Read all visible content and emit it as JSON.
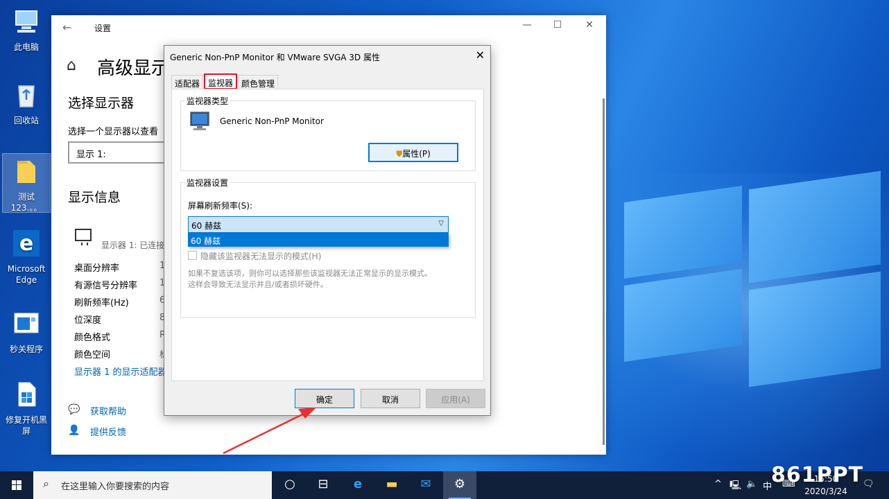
{
  "desktop": {
    "icons": [
      {
        "label": "此电脑",
        "icon": "computer-icon"
      },
      {
        "label": "回收站",
        "icon": "recycle-bin-icon"
      },
      {
        "label": "测试123.。。",
        "icon": "folder-icon"
      },
      {
        "label": "Microsoft Edge",
        "icon": "edge-icon"
      },
      {
        "label": "秒关程序",
        "icon": "app-window-icon"
      },
      {
        "label": "修复开机黑屏",
        "icon": "repair-icon"
      }
    ]
  },
  "settings": {
    "title": "设置",
    "page_title": "高级显示",
    "select_display_heading": "选择显示器",
    "select_display_label": "选择一个显示器以查看",
    "select_display_value": "显示 1:",
    "display_info_heading": "显示信息",
    "monitor_subtitle": "显示器 1: 已连接",
    "info_rows": [
      {
        "label": "桌面分辨率",
        "value": "1"
      },
      {
        "label": "有源信号分辨率",
        "value": "1"
      },
      {
        "label": "刷新频率(Hz)",
        "value": "6"
      },
      {
        "label": "位深度",
        "value": "8"
      },
      {
        "label": "颜色格式",
        "value": "R"
      },
      {
        "label": "颜色空间",
        "value": "标"
      }
    ],
    "adapter_link": "显示器 1 的显示适配器",
    "help_link": "获取帮助",
    "feedback_link": "提供反馈"
  },
  "dialog": {
    "title": "Generic Non-PnP Monitor 和 VMware SVGA 3D 属性",
    "tabs": [
      {
        "label": "适配器",
        "active": false
      },
      {
        "label": "监视器",
        "active": true
      },
      {
        "label": "颜色管理",
        "active": false
      }
    ],
    "monitor_type": {
      "legend": "监视器类型",
      "name": "Generic Non-PnP Monitor",
      "properties_button": "属性(P)"
    },
    "monitor_settings": {
      "legend": "监视器设置",
      "refresh_label": "屏幕刷新频率(S):",
      "refresh_value": "60 赫兹",
      "dropdown_option": "60 赫兹",
      "hide_modes_label": "隐藏该监视器无法显示的模式(H)",
      "hide_modes_checked": false,
      "note_line1": "如果不复选该项，则你可以选择那些该监视器无法正常显示的显示模式。",
      "note_line2": "这样会导致无法显示并且/或者损坏硬件。"
    },
    "buttons": {
      "ok": "确定",
      "cancel": "取消",
      "apply": "应用(A)"
    }
  },
  "taskbar": {
    "search_placeholder": "在这里输入你要搜索的内容",
    "ime": "中",
    "time": "15:50",
    "date": "2020/3/24"
  },
  "watermark": "861PPT",
  "colors": {
    "accent": "#0078d7",
    "highlight_red": "#e81123",
    "link": "#0063b1"
  }
}
